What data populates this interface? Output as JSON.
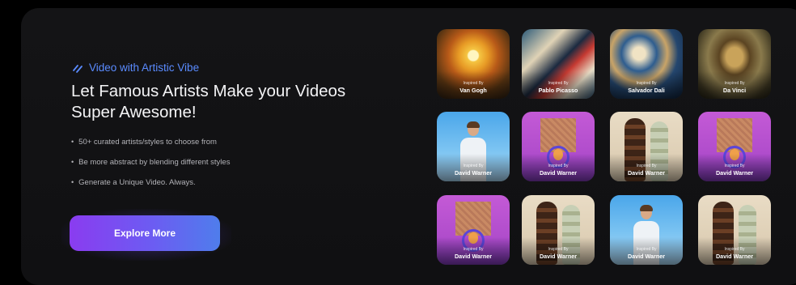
{
  "hero": {
    "eyebrow_icon": "brush-strokes-icon",
    "eyebrow": "Video with Artistic Vibe",
    "headline": "Let Famous Artists Make your Videos  Super Awesome!",
    "bullets": [
      "50+ curated artists/styles to choose from",
      "Be more abstract by blending different styles",
      "Generate a Unique Video. Always."
    ],
    "cta_label": "Explore More"
  },
  "colors": {
    "accent_blue": "#5a8bff",
    "cta_start": "#8a3cf0",
    "cta_end": "#4f7dec",
    "card_bg": "#141416"
  },
  "gallery": {
    "caption_prefix": "Inspired By",
    "tiles": [
      {
        "artist": "Van Gogh",
        "style": "vangogh"
      },
      {
        "artist": "Pablo Picasso",
        "style": "picasso"
      },
      {
        "artist": "Salvador Dali",
        "style": "dali"
      },
      {
        "artist": "Da Vinci",
        "style": "vinci"
      },
      {
        "artist": "David Warner",
        "style": "man"
      },
      {
        "artist": "David Warner",
        "style": "pink"
      },
      {
        "artist": "David Warner",
        "style": "tower"
      },
      {
        "artist": "David Warner",
        "style": "pink"
      },
      {
        "artist": "David Warner",
        "style": "pink"
      },
      {
        "artist": "David Warner",
        "style": "tower"
      },
      {
        "artist": "David Warner",
        "style": "man"
      },
      {
        "artist": "David Warner",
        "style": "tower"
      }
    ]
  }
}
